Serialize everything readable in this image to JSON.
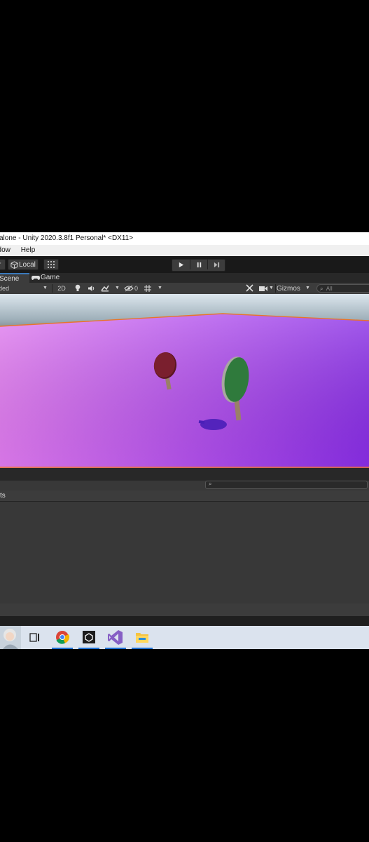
{
  "window": {
    "title": "alone - Unity 2020.3.8f1 Personal* <DX11>"
  },
  "menu": {
    "items": [
      "ndow",
      "Help"
    ]
  },
  "toolbar": {
    "tool_label": "r",
    "pivot_label": "Local"
  },
  "tabs": [
    "Scene",
    "Game"
  ],
  "scene_toolbar": {
    "shading_mode": "ded",
    "mode_2d": "2D",
    "hidden_count": "0",
    "gizmos": "Gizmos",
    "search_placeholder": "All"
  },
  "panels": {
    "project_header": "ts"
  },
  "colors": {
    "accent": "#3a79bb",
    "left_paddle": "#7a1f2e",
    "right_paddle": "#2f7a3c",
    "ground_left": "#e27cf2",
    "ground_right": "#8a2ee8",
    "selection_outline": "#e8742a"
  },
  "taskbar": {
    "apps": [
      "user-avatar",
      "task-view-icon",
      "chrome-icon",
      "unity-icon",
      "visual-studio-icon",
      "file-explorer-icon"
    ]
  }
}
